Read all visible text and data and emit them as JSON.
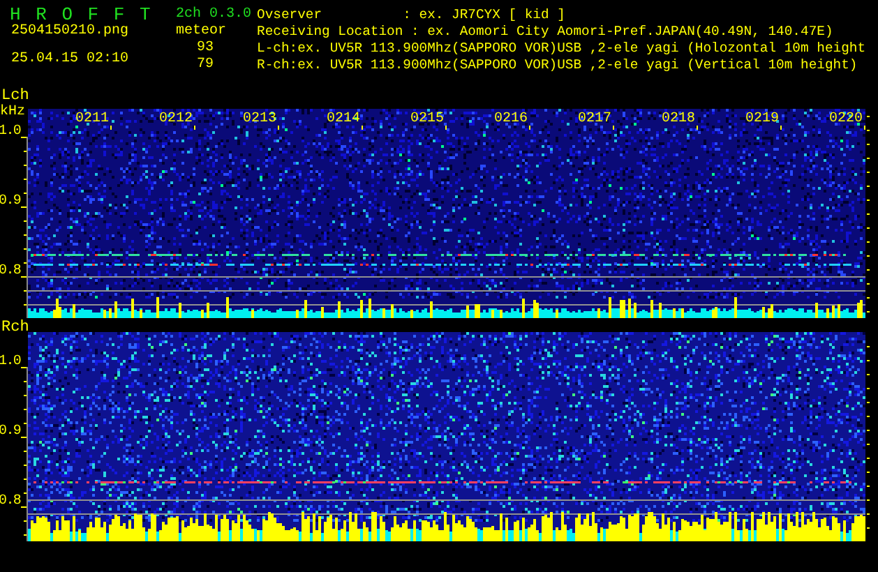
{
  "header": {
    "app_title": "H R O F F T",
    "version": "2ch 0.3.0",
    "mode": "meteor",
    "filename": "2504150210.png",
    "datetime": "25.04.15 02:10",
    "count_lch": "93",
    "count_rch": "79",
    "info_lines": [
      "Ovserver          : ex. JR7CYX [ kid ]",
      "Receiving Location : ex. Aomori City Aomori-Pref.JAPAN(40.49N, 140.47E)",
      "L-ch:ex. UV5R 113.900Mhz(SAPPORO VOR)USB ,2-ele yagi (Holozontal 10m height",
      "R-ch:ex. UV5R 113.900Mhz(SAPPORO VOR)USB ,2-ele yagi (Vertical 10m height)"
    ]
  },
  "panels": [
    {
      "channel": "Lch",
      "unit": "kHz",
      "y_labels": [
        "1.0",
        "0.9",
        "0.8"
      ],
      "time_labels": [
        "0211",
        "0212",
        "0213",
        "0214",
        "0215",
        "0216",
        "0217",
        "0218",
        "0219",
        "0220"
      ]
    },
    {
      "channel": "Rch",
      "y_labels": [
        "1.0",
        "0.9",
        "0.8"
      ]
    }
  ]
}
